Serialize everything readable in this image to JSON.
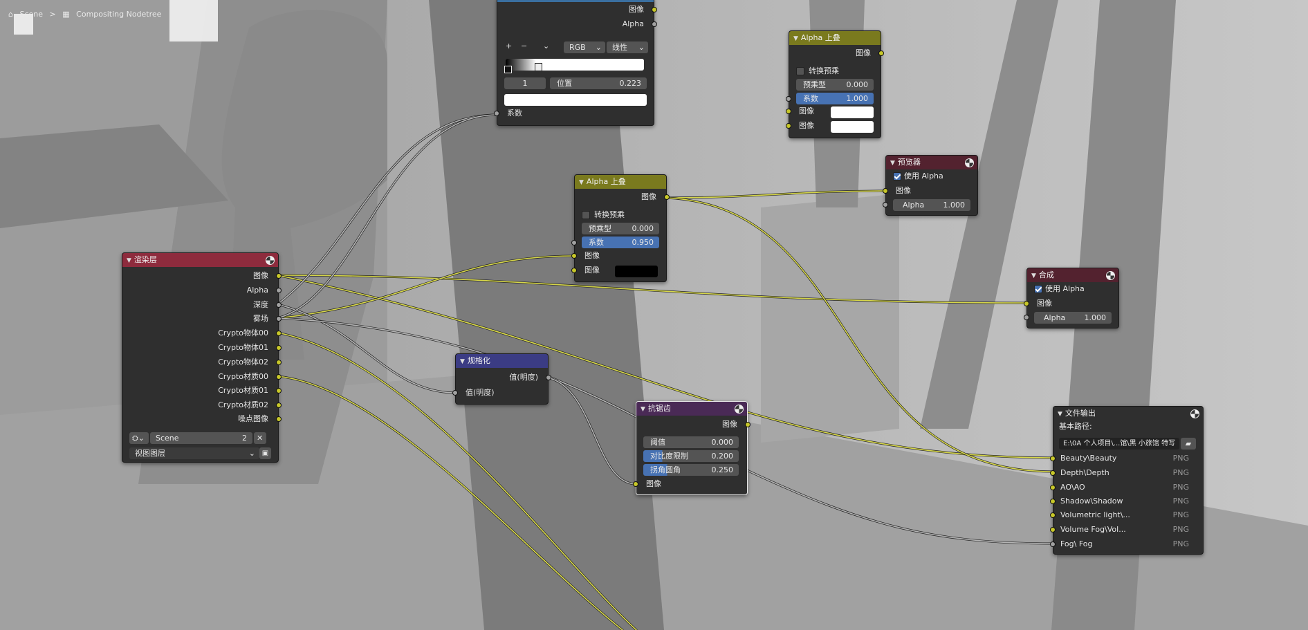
{
  "breadcrumb": {
    "scene": "Scene",
    "sep": ">",
    "nodetree": "Compositing Nodetree"
  },
  "colors": {
    "render_layers_header": "#8e2b3d",
    "mix_header": "#7a7a1e",
    "viewer_header": "#53222f",
    "normalize_header": "#3b3c84",
    "antialias_header": "#4a2a56",
    "output_header": "#2f2f2f",
    "wire_color": "#d8d84a",
    "wire_gray": "#b5b5b5",
    "accent": "#4772b3"
  },
  "color_ramp": {
    "outputs": [
      "图像",
      "Alpha"
    ],
    "mode": "RGB",
    "interp": "线性",
    "add": "+",
    "remove": "−",
    "more": "⌄",
    "stop_index": "1",
    "pos_label": "位置",
    "pos_value": "0.223",
    "input": "系数"
  },
  "alpha_over_top": {
    "title": "Alpha 上叠",
    "output": "图像",
    "convert": "转换预乘",
    "premul_label": "预乘型",
    "premul_value": "0.000",
    "fac_label": "系数",
    "fac_value": "1.000",
    "image1": "图像",
    "image2": "图像"
  },
  "alpha_over_mid": {
    "title": "Alpha 上叠",
    "output": "图像",
    "convert": "转换预乘",
    "premul_label": "预乘型",
    "premul_value": "0.000",
    "fac_label": "系数",
    "fac_value": "0.950",
    "image1": "图像",
    "image2": "图像"
  },
  "viewer": {
    "title": "预览器",
    "use_alpha": "使用 Alpha",
    "image": "图像",
    "alpha_label": "Alpha",
    "alpha_value": "1.000"
  },
  "composite": {
    "title": "合成",
    "use_alpha": "使用 Alpha",
    "image": "图像",
    "alpha_label": "Alpha",
    "alpha_value": "1.000"
  },
  "render_layers": {
    "title": "渲染层",
    "outputs": [
      "图像",
      "Alpha",
      "深度",
      "雾场",
      "Crypto物体00",
      "Crypto物体01",
      "Crypto物体02",
      "Crypto材质00",
      "Crypto材质01",
      "Crypto材质02",
      "噪点图像"
    ],
    "scene": "Scene",
    "users": "2",
    "view_layer": "视图图层"
  },
  "normalize": {
    "title": "规格化",
    "output": "值(明度)",
    "input": "值(明度)"
  },
  "antialias": {
    "title": "抗锯齿",
    "output": "图像",
    "threshold_label": "阈值",
    "threshold_value": "0.000",
    "contrast_label": "对比度限制",
    "contrast_value": "0.200",
    "corner_label": "拐角圆角",
    "corner_value": "0.250",
    "input": "图像"
  },
  "file_output": {
    "title": "文件输出",
    "base_path_label": "基本路径:",
    "base_path": "E:\\0A 个人项目\\...馆\\黑 小旅馆 特写",
    "slots": [
      {
        "name": "Beauty\\Beauty",
        "format": "PNG"
      },
      {
        "name": "Depth\\Depth",
        "format": "PNG"
      },
      {
        "name": "AO\\AO",
        "format": "PNG"
      },
      {
        "name": "Shadow\\Shadow",
        "format": "PNG"
      },
      {
        "name": "Volumetric light\\...",
        "format": "PNG"
      },
      {
        "name": "Volume Fog\\Vol...",
        "format": "PNG"
      },
      {
        "name": "Fog\\ Fog",
        "format": "PNG"
      }
    ]
  }
}
